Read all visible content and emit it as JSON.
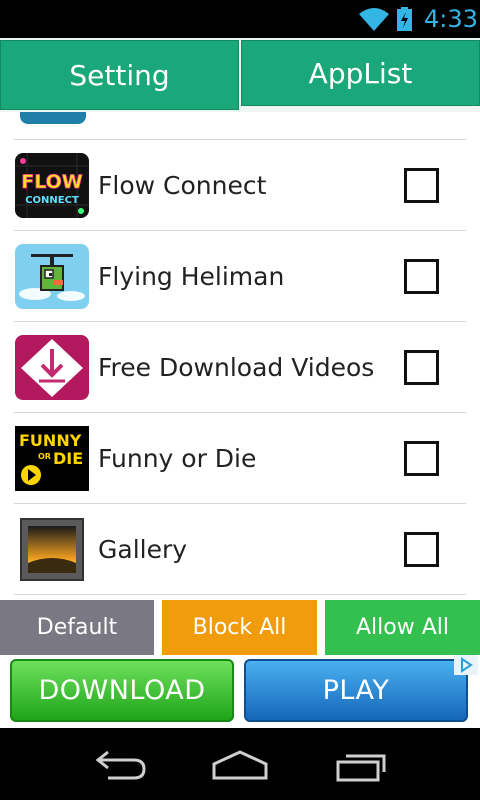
{
  "status_bar": {
    "time": "4:33",
    "wifi_icon": "wifi-icon",
    "battery_icon": "battery-charging-icon"
  },
  "tabs": [
    {
      "label": "Setting",
      "selected": false
    },
    {
      "label": "AppList",
      "selected": true
    }
  ],
  "apps": [
    {
      "name": "Flow Connect",
      "icon": "flow-connect-icon",
      "checked": false
    },
    {
      "name": "Flying Heliman",
      "icon": "flying-heliman-icon",
      "checked": false
    },
    {
      "name": "Free Download Videos",
      "icon": "free-download-videos-icon",
      "checked": false
    },
    {
      "name": "Funny or Die",
      "icon": "funny-or-die-icon",
      "checked": false
    },
    {
      "name": "Gallery",
      "icon": "gallery-icon",
      "checked": false
    }
  ],
  "icon_text": {
    "flow_line1": "FLOW",
    "flow_line2": "CONNECT",
    "funny_line1": "FUNNY",
    "funny_or": "OR",
    "funny_line2": "DIE"
  },
  "actions": {
    "default_label": "Default",
    "block_all_label": "Block All",
    "allow_all_label": "Allow All"
  },
  "ad": {
    "download_label": "DOWNLOAD",
    "play_label": "PLAY",
    "adchoices_icon": "adchoices-icon"
  },
  "nav": {
    "back_icon": "back-icon",
    "home_icon": "home-icon",
    "recent_icon": "recent-apps-icon"
  },
  "colors": {
    "tab_green": "#1aa87a",
    "status_blue": "#33b5e5",
    "default_gray": "#7a7882",
    "block_orange": "#f09c0c",
    "allow_green": "#34c04e"
  }
}
